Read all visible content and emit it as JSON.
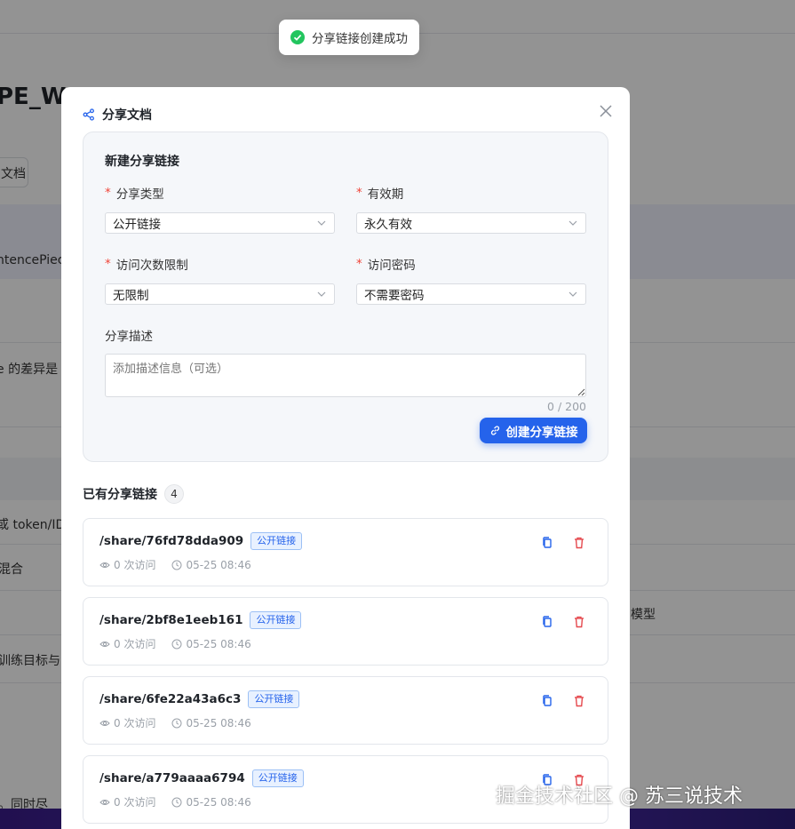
{
  "background": {
    "doc_title_fragment": "PE_Wo",
    "doc_button_fragment": "文档",
    "side_texts": [
      "ntencePiec",
      "e 的差异是",
      "或 token/ID",
      "混合",
      "训练目标与实",
      "。同时尽"
    ],
    "right_text": "模型",
    "footer_icon": "@"
  },
  "toast": {
    "message": "分享链接创建成功",
    "icon": "success-check-icon"
  },
  "modal": {
    "title": "分享文档",
    "create_section": {
      "title": "新建分享链接",
      "share_type": {
        "label": "分享类型",
        "value": "公开链接"
      },
      "validity": {
        "label": "有效期",
        "value": "永久有效"
      },
      "visit_limit": {
        "label": "访问次数限制",
        "value": "无限制"
      },
      "password": {
        "label": "访问密码",
        "value": "不需要密码"
      },
      "description": {
        "label": "分享描述",
        "placeholder": "添加描述信息（可选）",
        "counter": "0 / 200"
      },
      "create_button": "创建分享链接"
    },
    "existing": {
      "title": "已有分享链接",
      "count": "4",
      "links": [
        {
          "path": "/share/76fd78dda909",
          "tag": "公开链接",
          "visits": "0 次访问",
          "time": "05-25 08:46"
        },
        {
          "path": "/share/2bf8e1eeb161",
          "tag": "公开链接",
          "visits": "0 次访问",
          "time": "05-25 08:46"
        },
        {
          "path": "/share/6fe22a43a6c3",
          "tag": "公开链接",
          "visits": "0 次访问",
          "time": "05-25 08:46"
        },
        {
          "path": "/share/a779aaaa6794",
          "tag": "公开链接",
          "visits": "0 次访问",
          "time": "05-25 08:46"
        }
      ]
    }
  },
  "watermark": "掘金技术社区 @ 苏三说技术",
  "colors": {
    "primary": "#2563eb",
    "danger": "#e5484d",
    "success": "#22c55e",
    "required": "#f04438"
  }
}
